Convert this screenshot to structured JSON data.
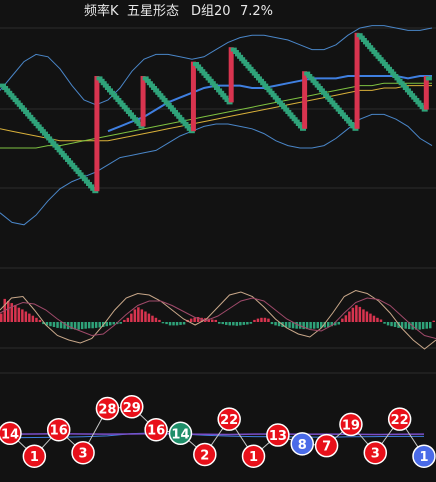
{
  "header": {
    "title": "频率K",
    "subtitle": "五星形态",
    "group": "D组20",
    "percent": "7.2%"
  },
  "colors": {
    "background": "#121212",
    "up": "#d8344f",
    "down": "#2fa37a",
    "band": "#4a86c8",
    "ma_blue": "#3f7fe0",
    "ma_yellow": "#d9b13a",
    "ma_green": "#7fc241",
    "macd_line": "#c9a88a",
    "macd_signal": "#a04a6a",
    "ball_red": "#e8101a",
    "ball_green": "#1f8f6a",
    "ball_blue": "#4a6be8",
    "count_line": "#c8c8c8",
    "count_line2": "#7a4ec8"
  },
  "chart_data": [
    {
      "type": "line",
      "name": "frequency-k",
      "ylim": [
        0,
        10
      ],
      "series": [
        {
          "name": "close",
          "values": [
            7.6,
            7.5,
            7.4,
            7.3,
            7.2,
            7.1,
            7.0,
            6.9,
            6.8,
            6.7,
            6.6,
            6.5,
            6.4,
            6.3,
            6.2,
            6.1,
            6.0,
            5.9,
            5.8,
            5.7,
            5.6,
            5.5,
            5.4,
            5.3,
            5.2,
            5.1,
            5.0,
            4.9,
            4.8,
            4.7,
            4.6,
            4.5,
            4.4,
            4.3,
            4.2,
            4.1,
            4.0,
            3.9,
            3.8,
            3.7,
            3.6,
            3.5,
            3.4,
            3.3,
            3.2,
            8.0,
            7.9,
            7.8,
            7.7,
            7.6,
            7.5,
            7.4,
            7.3,
            7.2,
            7.1,
            7.0,
            6.9,
            6.8,
            6.7,
            6.6,
            6.5,
            6.4,
            6.3,
            6.2,
            6.1,
            6.0,
            5.9,
            8.0,
            7.9,
            7.8,
            7.7,
            7.6,
            7.5,
            7.4,
            7.3,
            7.2,
            7.1,
            7.0,
            6.9,
            6.8,
            6.7,
            6.6,
            6.5,
            6.4,
            6.3,
            6.2,
            6.1,
            6.0,
            5.9,
            5.8,
            5.7,
            8.6,
            8.5,
            8.4,
            8.3,
            8.2,
            8.1,
            8.0,
            7.9,
            7.8,
            7.7,
            7.6,
            7.5,
            7.4,
            7.3,
            7.2,
            7.1,
            7.0,
            6.9,
            9.2,
            9.1,
            9.0,
            8.9,
            8.8,
            8.7,
            8.6,
            8.5,
            8.4,
            8.3,
            8.2,
            8.1,
            8.0,
            7.9,
            7.8,
            7.7,
            7.6,
            7.5,
            7.4,
            7.3,
            7.2,
            7.1,
            7.0,
            6.9,
            6.8,
            6.7,
            6.6,
            6.5,
            6.4,
            6.3,
            6.2,
            6.1,
            6.0,
            5.9,
            5.8,
            8.2,
            8.1,
            8.0,
            7.9,
            7.8,
            7.7,
            7.6,
            7.5,
            7.4,
            7.3,
            7.2,
            7.1,
            7.0,
            6.9,
            6.8,
            6.7,
            6.6,
            6.5,
            6.4,
            6.3,
            6.2,
            6.1,
            6.0,
            5.9,
            5.8,
            9.8,
            9.7,
            9.6,
            9.5,
            9.4,
            9.3,
            9.2,
            9.1,
            9.0,
            8.9,
            8.8,
            8.7,
            8.6,
            8.5,
            8.4,
            8.3,
            8.2,
            8.1,
            8.0,
            7.9,
            7.8,
            7.7,
            7.6,
            7.5,
            7.4,
            7.3,
            7.2,
            7.1,
            7.0,
            6.9,
            6.8,
            6.7,
            6.6,
            8.0,
            7.9
          ]
        },
        {
          "name": "band_upper",
          "values": [
            7.4,
            8.0,
            8.6,
            8.9,
            8.8,
            8.3,
            7.6,
            7.0,
            6.8,
            7.0,
            7.5,
            8.2,
            8.7,
            8.9,
            8.9,
            8.8,
            8.7,
            8.8,
            9.1,
            9.4,
            9.6,
            9.7,
            9.7,
            9.6,
            9.5,
            9.3,
            9.1,
            9.1,
            9.3,
            9.7,
            10.0,
            10.1,
            10.1,
            10.0,
            9.9,
            9.9,
            10.0
          ]
        },
        {
          "name": "band_lower",
          "values": [
            2.3,
            1.9,
            1.8,
            2.2,
            2.8,
            3.3,
            3.6,
            3.8,
            4.0,
            4.3,
            4.6,
            4.7,
            4.8,
            4.9,
            5.2,
            5.5,
            5.7,
            5.9,
            6.0,
            6.0,
            5.9,
            5.8,
            5.6,
            5.3,
            5.1,
            5.0,
            5.0,
            5.1,
            5.4,
            5.8,
            6.2,
            6.4,
            6.4,
            6.2,
            5.9,
            5.4,
            5.1
          ]
        },
        {
          "name": "ma_blue",
          "values": [
            null,
            null,
            null,
            null,
            null,
            null,
            null,
            null,
            null,
            5.7,
            5.9,
            6.1,
            6.3,
            6.6,
            6.9,
            7.1,
            7.3,
            7.5,
            7.6,
            7.6,
            7.6,
            7.5,
            7.5,
            7.6,
            7.7,
            7.8,
            7.9,
            7.9,
            7.9,
            8.0,
            8.0,
            8.0,
            8.0,
            8.0,
            7.9,
            8.0,
            8.0
          ]
        },
        {
          "name": "ma_yellow",
          "values": [
            5.8,
            5.7,
            5.6,
            5.5,
            5.4,
            5.3,
            5.3,
            5.3,
            5.3,
            5.3,
            5.4,
            5.5,
            5.6,
            5.7,
            5.8,
            5.9,
            6.0,
            6.1,
            6.2,
            6.3,
            6.4,
            6.5,
            6.6,
            6.7,
            6.8,
            6.9,
            7.0,
            7.1,
            7.2,
            7.3,
            7.4,
            7.4,
            7.5,
            7.5,
            7.6,
            7.6,
            7.6
          ]
        },
        {
          "name": "ma_green",
          "values": [
            5.0,
            5.0,
            5.0,
            5.0,
            5.1,
            5.1,
            5.2,
            5.3,
            5.4,
            5.5,
            5.6,
            5.7,
            5.8,
            5.9,
            6.0,
            6.1,
            6.2,
            6.3,
            6.4,
            6.5,
            6.6,
            6.7,
            6.8,
            6.9,
            7.0,
            7.1,
            7.2,
            7.3,
            7.4,
            7.5,
            7.6,
            7.6,
            7.7,
            7.7,
            7.7,
            7.7,
            7.7
          ]
        }
      ]
    },
    {
      "type": "bar",
      "name": "macd",
      "ylim": [
        -1,
        1
      ],
      "values": [
        0.2,
        0.55,
        0.5,
        0.45,
        0.4,
        0.34,
        0.3,
        0.25,
        0.2,
        0.15,
        0.1,
        0.05,
        -0.05,
        -0.08,
        -0.1,
        -0.12,
        -0.14,
        -0.15,
        -0.16,
        -0.17,
        -0.17,
        -0.18,
        -0.18,
        -0.17,
        -0.16,
        -0.15,
        -0.15,
        -0.14,
        -0.13,
        -0.12,
        -0.1,
        -0.08,
        -0.06,
        -0.05,
        -0.04,
        0.05,
        0.1,
        0.2,
        0.3,
        0.35,
        0.3,
        0.25,
        0.2,
        0.15,
        0.1,
        0.05,
        -0.03,
        -0.05,
        -0.08,
        -0.08,
        -0.08,
        -0.07,
        -0.06,
        0.05,
        0.08,
        0.1,
        0.12,
        0.1,
        0.09,
        0.08,
        0.06,
        0.05,
        -0.04,
        -0.05,
        -0.07,
        -0.08,
        -0.08,
        -0.09,
        -0.08,
        -0.07,
        -0.06,
        -0.04,
        0.05,
        0.08,
        0.1,
        0.1,
        0.08,
        -0.05,
        -0.08,
        -0.1,
        -0.12,
        -0.13,
        -0.14,
        -0.15,
        -0.16,
        -0.16,
        -0.17,
        -0.17,
        -0.16,
        -0.16,
        -0.15,
        -0.14,
        -0.13,
        -0.12,
        -0.1,
        -0.08,
        -0.06,
        0.08,
        0.16,
        0.25,
        0.34,
        0.4,
        0.36,
        0.3,
        0.25,
        0.2,
        0.15,
        0.1,
        0.06,
        -0.04,
        -0.08,
        -0.1,
        -0.12,
        -0.14,
        -0.15,
        -0.16,
        -0.17,
        -0.18,
        -0.18,
        -0.18,
        -0.17,
        -0.16,
        -0.15,
        0.03
      ],
      "series": [
        {
          "name": "dif",
          "values": [
            0.4,
            0.8,
            0.85,
            0.4,
            -0.1,
            -0.45,
            -0.6,
            -0.7,
            -0.55,
            -0.1,
            0.4,
            0.8,
            0.95,
            0.9,
            0.7,
            0.4,
            0.1,
            -0.1,
            0.1,
            0.5,
            0.9,
            1.0,
            0.85,
            0.5,
            0.1,
            -0.2,
            -0.4,
            -0.5,
            -0.2,
            0.3,
            0.85,
            1.05,
            0.95,
            0.7,
            0.3,
            -0.2,
            -0.6,
            -0.9,
            -0.6
          ]
        },
        {
          "name": "dea",
          "values": [
            0.3,
            0.5,
            0.65,
            0.6,
            0.4,
            0.1,
            -0.15,
            -0.3,
            -0.45,
            -0.4,
            -0.1,
            0.25,
            0.55,
            0.7,
            0.7,
            0.55,
            0.35,
            0.15,
            0.05,
            0.2,
            0.45,
            0.7,
            0.8,
            0.7,
            0.4,
            0.1,
            -0.1,
            -0.25,
            -0.3,
            -0.1,
            0.3,
            0.65,
            0.8,
            0.75,
            0.55,
            0.2,
            -0.15,
            -0.45,
            -0.55
          ]
        }
      ]
    },
    {
      "type": "line",
      "name": "counts",
      "ylim": [
        0,
        30
      ],
      "series": [
        {
          "name": "count",
          "values": [
            14,
            1,
            16,
            3,
            28,
            29,
            16,
            14,
            2,
            22,
            1,
            13,
            8,
            7,
            19,
            3,
            22,
            1
          ]
        },
        {
          "name": "avg_purple",
          "values": [
            13.5,
            13.6,
            13.7,
            13.6,
            13.5,
            13.6,
            13.8,
            13.5,
            13.4,
            13.3,
            13.5,
            13.6,
            13.4,
            13.5,
            13.4,
            13.3,
            13.4,
            13.5
          ]
        },
        {
          "name": "avg_blue",
          "values": [
            11.5,
            11.6,
            11.8,
            12.0,
            12.5,
            13.8,
            14.2,
            13.6,
            12.9,
            12.4,
            12.1,
            12.0,
            11.9,
            11.8,
            12.0,
            12.1,
            12.2,
            12.2
          ]
        }
      ],
      "balls": [
        {
          "label": "14",
          "value": 14,
          "color": "red"
        },
        {
          "label": "1",
          "value": 1,
          "color": "red"
        },
        {
          "label": "16",
          "value": 16,
          "color": "red"
        },
        {
          "label": "3",
          "value": 3,
          "color": "red"
        },
        {
          "label": "28",
          "value": 28,
          "color": "red"
        },
        {
          "label": "29",
          "value": 29,
          "color": "red"
        },
        {
          "label": "16",
          "value": 16,
          "color": "red"
        },
        {
          "label": "14",
          "value": 14,
          "color": "green"
        },
        {
          "label": "2",
          "value": 2,
          "color": "red"
        },
        {
          "label": "22",
          "value": 22,
          "color": "red"
        },
        {
          "label": "1",
          "value": 1,
          "color": "red"
        },
        {
          "label": "13",
          "value": 13,
          "color": "red"
        },
        {
          "label": "8",
          "value": 8,
          "color": "blue"
        },
        {
          "label": "7",
          "value": 7,
          "color": "red"
        },
        {
          "label": "19",
          "value": 19,
          "color": "red"
        },
        {
          "label": "3",
          "value": 3,
          "color": "red"
        },
        {
          "label": "22",
          "value": 22,
          "color": "red"
        },
        {
          "label": "1",
          "value": 1,
          "color": "blue"
        }
      ]
    }
  ]
}
